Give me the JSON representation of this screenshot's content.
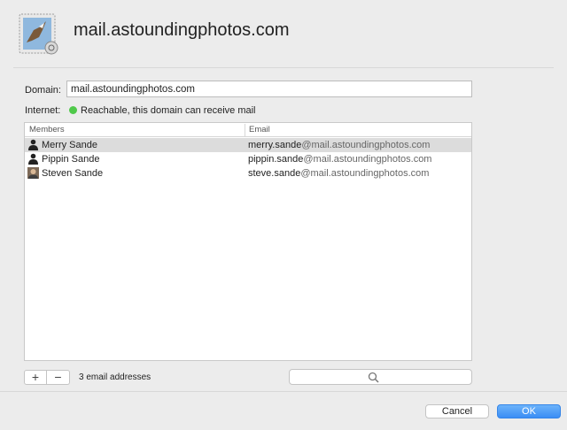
{
  "window": {
    "title": "mail.astoundingphotos.com",
    "app_icon": "mail-stamp-eagle-icon"
  },
  "form": {
    "domain_label": "Domain:",
    "domain_value": "mail.astoundingphotos.com",
    "internet_label": "Internet:",
    "internet_status": "Reachable, this domain can receive mail",
    "status_color": "#4fc94a"
  },
  "table": {
    "columns": [
      "Members",
      "Email"
    ],
    "rows": [
      {
        "name": "Merry Sande",
        "email_user": "merry.sande",
        "email_domain": "@mail.astoundingphotos.com",
        "avatar": "person-silhouette-icon",
        "selected": true
      },
      {
        "name": "Pippin Sande",
        "email_user": "pippin.sande",
        "email_domain": "@mail.astoundingphotos.com",
        "avatar": "person-silhouette-icon",
        "selected": false
      },
      {
        "name": "Steven Sande",
        "email_user": "steve.sande",
        "email_domain": "@mail.astoundingphotos.com",
        "avatar": "photo-avatar-icon",
        "selected": false
      }
    ]
  },
  "toolbar": {
    "add_label": "+",
    "remove_label": "−",
    "count_text": "3 email addresses",
    "search_icon": "magnifier-icon"
  },
  "buttons": {
    "cancel": "Cancel",
    "ok": "OK",
    "accent": "#3a8df5"
  }
}
